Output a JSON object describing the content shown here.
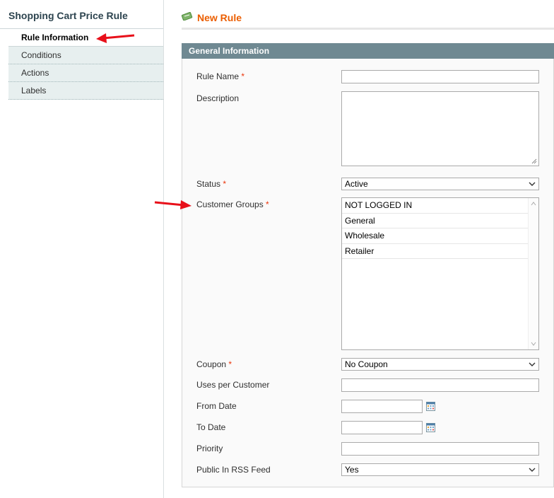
{
  "sidebar": {
    "title": "Shopping Cart Price Rule",
    "tabs": [
      {
        "label": "Rule Information",
        "active": true
      },
      {
        "label": "Conditions",
        "active": false
      },
      {
        "label": "Actions",
        "active": false
      },
      {
        "label": "Labels",
        "active": false
      }
    ]
  },
  "header": {
    "title": "New Rule",
    "icon": "rule-icon"
  },
  "form": {
    "section_title": "General Information",
    "required_mark": "*",
    "rule_name": {
      "label": "Rule Name",
      "value": ""
    },
    "description": {
      "label": "Description",
      "value": ""
    },
    "status": {
      "label": "Status",
      "value": "Active"
    },
    "customer_groups": {
      "label": "Customer Groups",
      "options": [
        "NOT LOGGED IN",
        "General",
        "Wholesale",
        "Retailer"
      ]
    },
    "coupon": {
      "label": "Coupon",
      "value": "No Coupon"
    },
    "uses_per_customer": {
      "label": "Uses per Customer",
      "value": ""
    },
    "from_date": {
      "label": "From Date",
      "value": ""
    },
    "to_date": {
      "label": "To Date",
      "value": ""
    },
    "priority": {
      "label": "Priority",
      "value": ""
    },
    "rss_feed": {
      "label": "Public In RSS Feed",
      "value": "Yes"
    }
  },
  "colors": {
    "accent": "#eb5e00",
    "section_header": "#6f8992",
    "required": "#eb340a",
    "annotation_arrow": "#e8101a"
  }
}
